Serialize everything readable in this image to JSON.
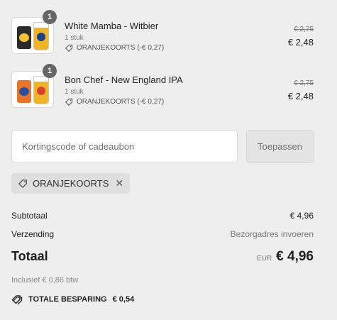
{
  "items": [
    {
      "name": "White Mamba - Witbier",
      "quantity_badge": "1",
      "quantity_text": "1 stuk",
      "discount_label": "ORANJEKOORTS (-€ 0,27)",
      "original_price": "€ 2,75",
      "price": "€ 2,48",
      "can_color": "#2a2a2a",
      "can_label_color": "#f2c230"
    },
    {
      "name": "Bon Chef - New England IPA",
      "quantity_badge": "1",
      "quantity_text": "1 stuk",
      "discount_label": "ORANJEKOORTS (-€ 0,27)",
      "original_price": "€ 2,75",
      "price": "€ 2,48",
      "can_color": "#e8742a",
      "can_label_color": "#2a4fa0"
    }
  ],
  "coupon": {
    "placeholder": "Kortingscode of cadeaubon",
    "apply_label": "Toepassen",
    "applied_code": "ORANJEKOORTS",
    "remove_symbol": "✕"
  },
  "summary": {
    "subtotal_label": "Subtotaal",
    "subtotal_value": "€ 4,96",
    "shipping_label": "Verzending",
    "shipping_value": "Bezorgadres invoeren",
    "total_label": "Totaal",
    "currency": "EUR",
    "total_value": "€ 4,96",
    "tax_note": "Inclusief € 0,86 btw",
    "savings_label": "TOTALE BESPARING",
    "savings_value": "€ 0,54"
  }
}
